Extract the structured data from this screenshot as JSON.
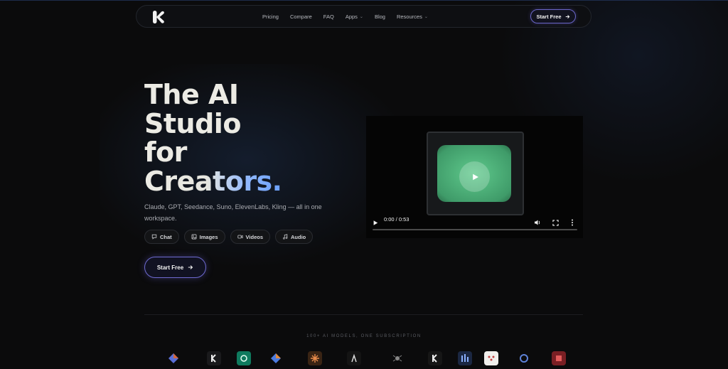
{
  "nav": {
    "links": [
      {
        "label": "Pricing",
        "dropdown": false
      },
      {
        "label": "Compare",
        "dropdown": false
      },
      {
        "label": "FAQ",
        "dropdown": false
      },
      {
        "label": "Apps",
        "dropdown": true
      },
      {
        "label": "Blog",
        "dropdown": false
      },
      {
        "label": "Resources",
        "dropdown": true
      }
    ],
    "cta_label": "Start Free"
  },
  "hero": {
    "headline": {
      "line1": "The AI",
      "line2": "Studio",
      "line3": "for",
      "line4": "Creators."
    },
    "subtitle": "Claude, GPT, Seedance, Suno, ElevenLabs, Kling — all in one workspace.",
    "chips": [
      {
        "label": "Chat",
        "icon": "chat-icon"
      },
      {
        "label": "Images",
        "icon": "image-icon"
      },
      {
        "label": "Videos",
        "icon": "video-icon"
      },
      {
        "label": "Audio",
        "icon": "music-icon"
      }
    ],
    "cta_label": "Start Free"
  },
  "video": {
    "time": "0:00 / 0:53",
    "progress": 0
  },
  "models": {
    "caption": "100+ AI MODELS, ONE SUBSCRIPTION"
  },
  "colors": {
    "background": "#0b0b0c",
    "accent": "#6e6ad0",
    "headline_gradient_end": "#6aa0ff"
  }
}
